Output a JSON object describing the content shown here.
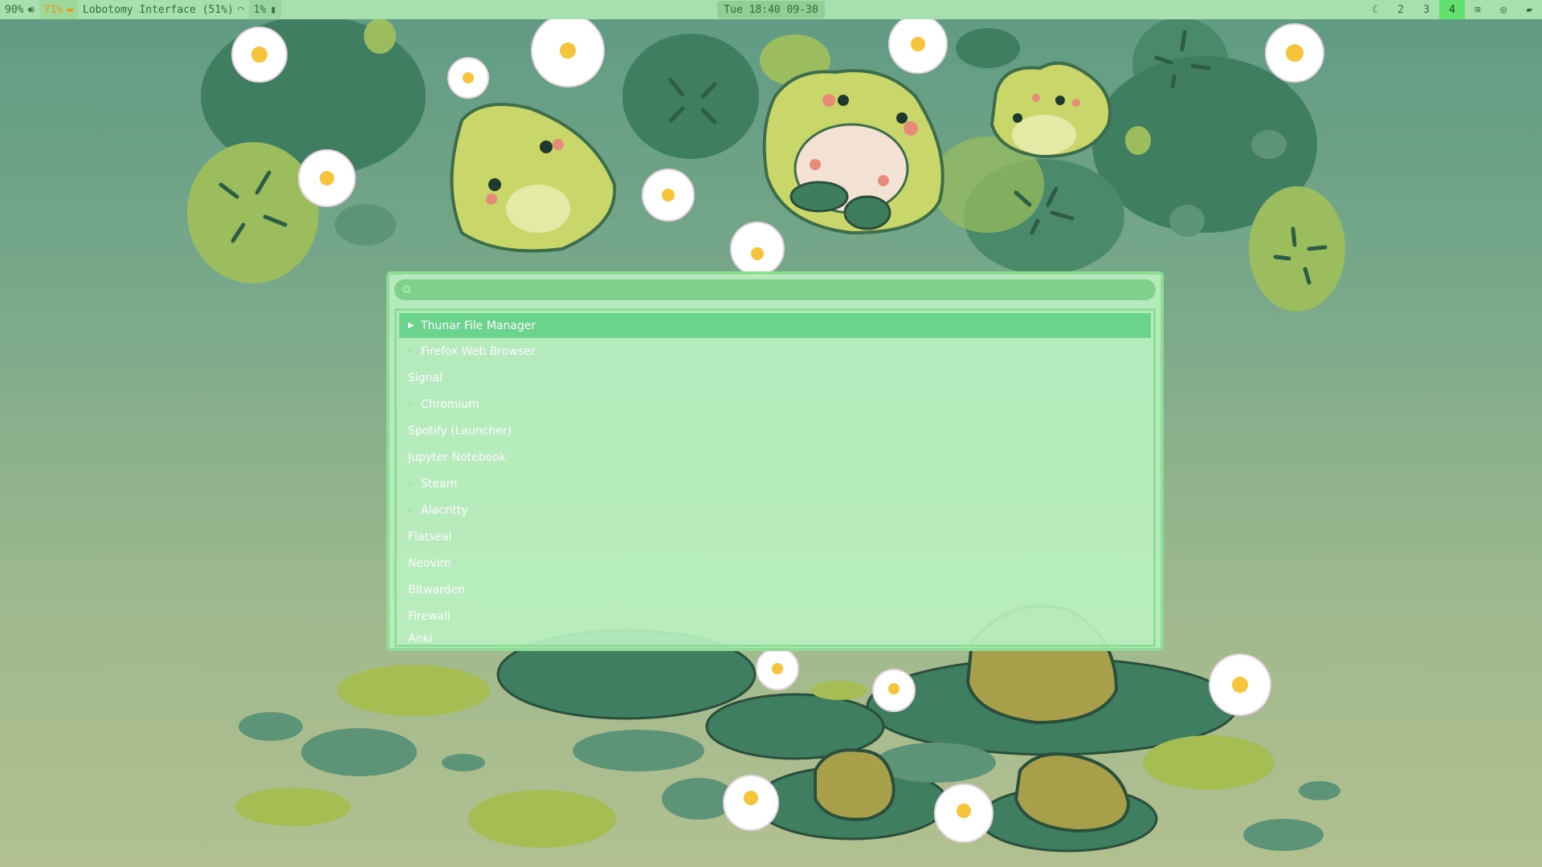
{
  "topbar": {
    "volume": "90%",
    "brightness": "71%",
    "window_title": "Lobotomy Interface (51%)",
    "cpu": "1%",
    "datetime": "Tue 18:40 09-30",
    "workspaces": [
      {
        "label": "",
        "icon": "moon-icon"
      },
      {
        "label": "2"
      },
      {
        "label": "3"
      },
      {
        "label": "4",
        "active": true
      },
      {
        "label": "",
        "icon": "spotify-icon"
      },
      {
        "label": "",
        "icon": "chromium-icon"
      },
      {
        "label": "",
        "icon": "folder-icon"
      }
    ]
  },
  "launcher": {
    "search_placeholder": "",
    "items": [
      {
        "label": "Thunar File Manager",
        "expandable": true,
        "selected": true
      },
      {
        "label": "Firefox Web Browser",
        "expandable": true
      },
      {
        "label": "Signal",
        "expandable": false
      },
      {
        "label": "Chromium",
        "expandable": true
      },
      {
        "label": "Spotify (Launcher)",
        "expandable": false
      },
      {
        "label": "Jupyter Notebook",
        "expandable": false
      },
      {
        "label": "Steam",
        "expandable": true
      },
      {
        "label": "Alacritty",
        "expandable": true
      },
      {
        "label": "Flatseal",
        "expandable": false
      },
      {
        "label": "Neovim",
        "expandable": false
      },
      {
        "label": "Bitwarden",
        "expandable": false
      },
      {
        "label": "Firewall",
        "expandable": false
      },
      {
        "label": "Anki",
        "expandable": false
      }
    ]
  },
  "colors": {
    "bar_bg": "#a8dfae",
    "bar_text": "#2f6d3e",
    "warn": "#e89a1a",
    "active_workspace": "#63e06f",
    "launcher_bg": "#baf0c0",
    "launcher_border": "#8fdc97",
    "selected_bg": "#6ad48c"
  }
}
